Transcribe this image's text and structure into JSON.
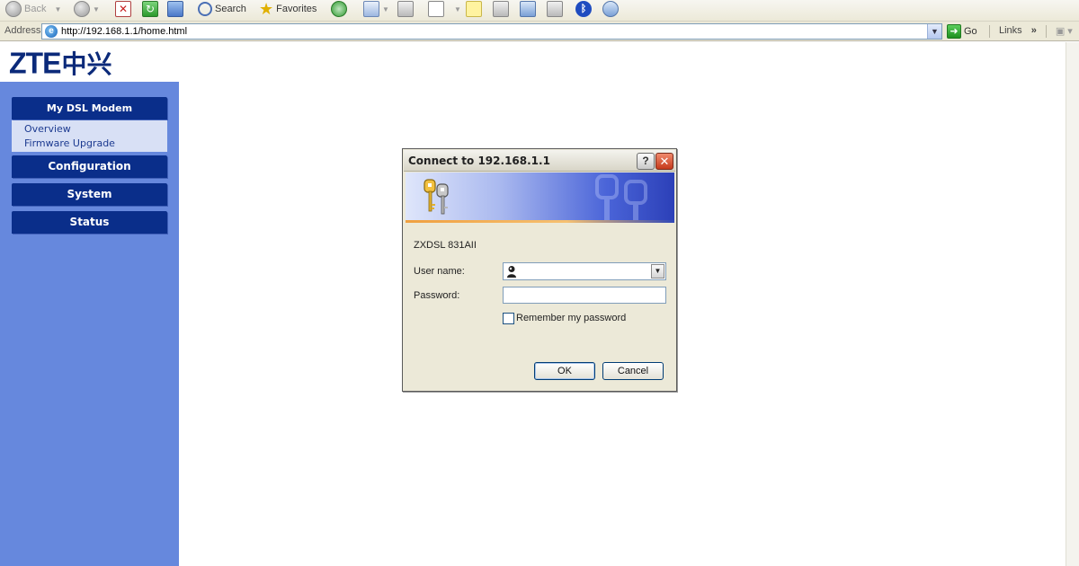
{
  "toolbar": {
    "back_label": "Back",
    "search_label": "Search",
    "favorites_label": "Favorites",
    "icons": [
      "back-icon",
      "forward-icon",
      "stop-icon",
      "refresh-icon",
      "home-icon",
      "search-icon",
      "favorites-icon",
      "history-icon",
      "mail-icon",
      "print-icon",
      "edit-icon",
      "note-icon",
      "messenger-icon",
      "bluetooth-icon"
    ]
  },
  "address_bar": {
    "label": "Address",
    "url": "http://192.168.1.1/home.html",
    "go_label": "Go",
    "links_label": "Links",
    "chevron": "»"
  },
  "page": {
    "logo_text": "ZTE",
    "logo_cn": "中兴",
    "menu": {
      "my_dsl_modem": "My DSL Modem",
      "submenu_items": [
        "Overview",
        "Firmware Upgrade"
      ],
      "configuration": "Configuration",
      "system": "System",
      "status": "Status"
    }
  },
  "dialog": {
    "title": "Connect to 192.168.1.1",
    "help_glyph": "?",
    "close_glyph": "✕",
    "product": "ZXDSL 831AII",
    "username_label": "User name:",
    "username_value": "",
    "password_label": "Password:",
    "password_value": "",
    "remember_label": "Remember my password",
    "remember_checked": false,
    "ok_label": "OK",
    "cancel_label": "Cancel"
  },
  "colors": {
    "sidebar": "#6688dd",
    "menu_header": "#0a2e8a",
    "submenu_bg": "#d8e0f5",
    "logo": "#0b2a7a"
  }
}
